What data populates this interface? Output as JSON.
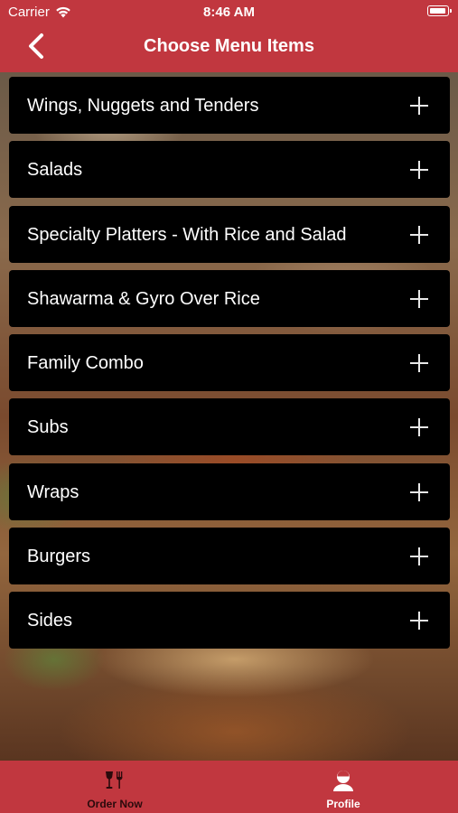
{
  "status_bar": {
    "carrier": "Carrier",
    "time": "8:46 AM"
  },
  "header": {
    "title": "Choose Menu Items",
    "back_icon": "chevron-left-icon",
    "background_color": "#c1373f"
  },
  "menu": {
    "expand_icon": "plus-icon",
    "items": [
      {
        "label": "Wings, Nuggets and Tenders"
      },
      {
        "label": "Salads"
      },
      {
        "label": "Specialty Platters - With Rice and Salad"
      },
      {
        "label": "Shawarma & Gyro Over Rice"
      },
      {
        "label": "Family Combo"
      },
      {
        "label": "Subs"
      },
      {
        "label": "Wraps"
      },
      {
        "label": "Burgers"
      },
      {
        "label": "Sides"
      }
    ]
  },
  "tab_bar": {
    "background_color": "#c1373f",
    "tabs": [
      {
        "label": "Order Now",
        "icon": "fork-wine-glass-icon",
        "selected": false
      },
      {
        "label": "Profile",
        "icon": "user-profile-icon",
        "selected": true
      }
    ]
  }
}
